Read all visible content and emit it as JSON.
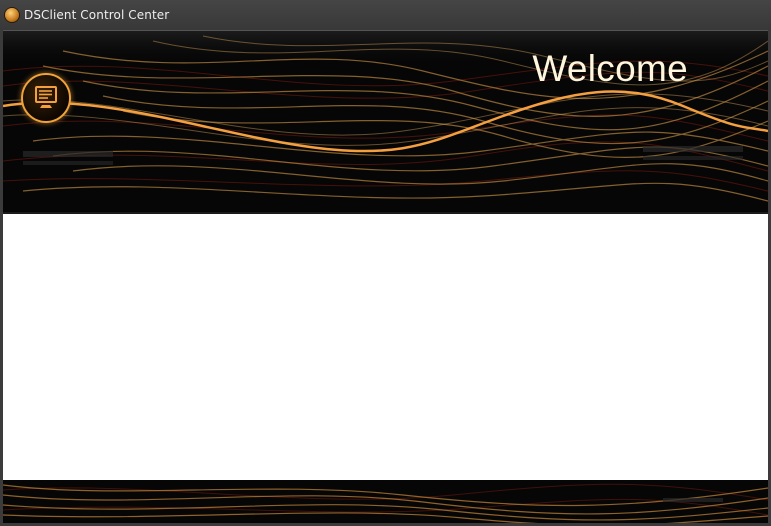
{
  "window": {
    "title": "DSClient Control Center",
    "icon": "dsclient-app-icon"
  },
  "header": {
    "welcome_text": "Welcome",
    "logo_icon": "computer-monitor-icon",
    "accent_color": "#f0a33c",
    "background_color": "#050505"
  },
  "content": {
    "background_color": "#ffffff"
  },
  "footer": {
    "accent_color": "#c8893a"
  }
}
